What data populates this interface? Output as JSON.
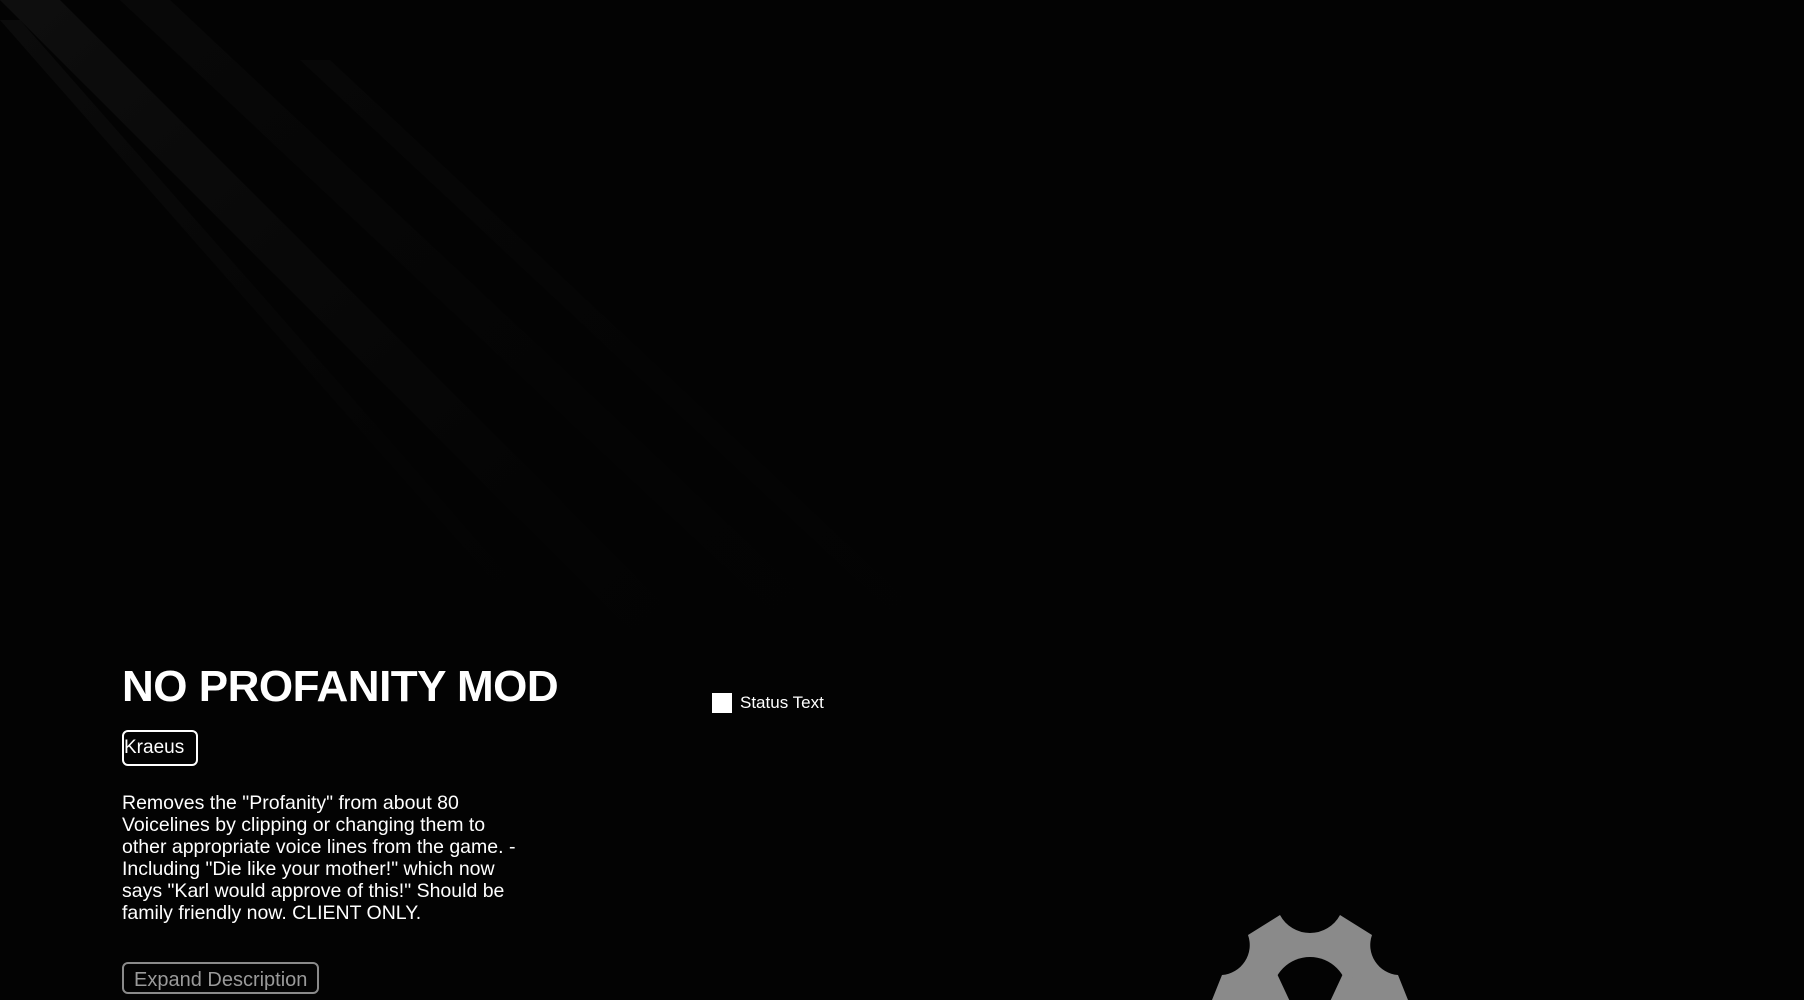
{
  "mod": {
    "title": "NO PROFANITY MOD",
    "author": "Kraeus",
    "description": "Removes the \"Profanity\" from about 80 Voicelines by clipping or changing them to other appropriate voice lines from the game. -Including \"Die like your mother!\" which now says \"Karl would approve of this!\" Should be family friendly now. CLIENT ONLY.",
    "expand_label": "Expand Description"
  },
  "status": {
    "text": "Status Text",
    "icon": "status-square-icon"
  },
  "decor": {
    "icon": "gear-icon",
    "gear_color": "#8a8a8a",
    "background_color": "#030303"
  }
}
